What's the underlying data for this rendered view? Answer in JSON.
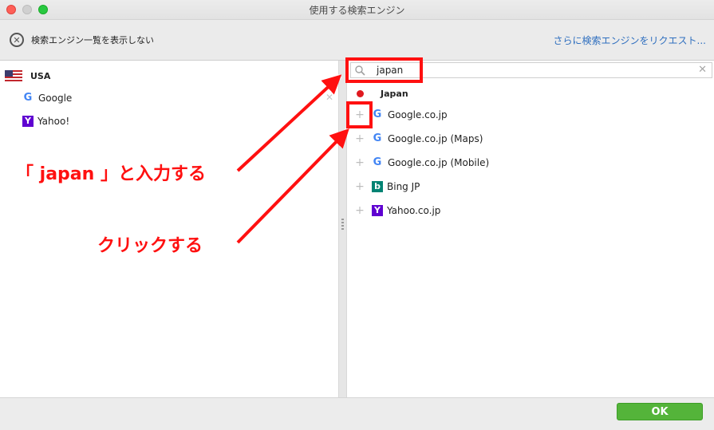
{
  "window": {
    "title": "使用する検索エンジン"
  },
  "toolbar": {
    "hide_list_label": "検索エンジン一覧を表示しない",
    "request_link": "さらに検索エンジンをリクエスト..."
  },
  "left_pane": {
    "region": "USA",
    "engines": [
      {
        "name": "Google",
        "icon": "google-icon"
      },
      {
        "name": "Yahoo!",
        "icon": "yahoo-icon"
      }
    ]
  },
  "right_pane": {
    "search": {
      "value": "japan",
      "placeholder": ""
    },
    "region": "Japan",
    "results": [
      {
        "name": "Google.co.jp",
        "icon": "google-icon"
      },
      {
        "name": "Google.co.jp (Maps)",
        "icon": "google-icon"
      },
      {
        "name": "Google.co.jp (Mobile)",
        "icon": "google-icon"
      },
      {
        "name": "Bing JP",
        "icon": "bing-icon"
      },
      {
        "name": "Yahoo.co.jp",
        "icon": "yahoo-icon"
      }
    ]
  },
  "footer": {
    "ok_label": "OK"
  },
  "annotations": {
    "type_instruction": "「 japan 」と入力する",
    "click_instruction": "クリックする"
  },
  "colors": {
    "accent": "#54b43a",
    "link": "#2f6fbf",
    "annotation": "#ff1010"
  }
}
